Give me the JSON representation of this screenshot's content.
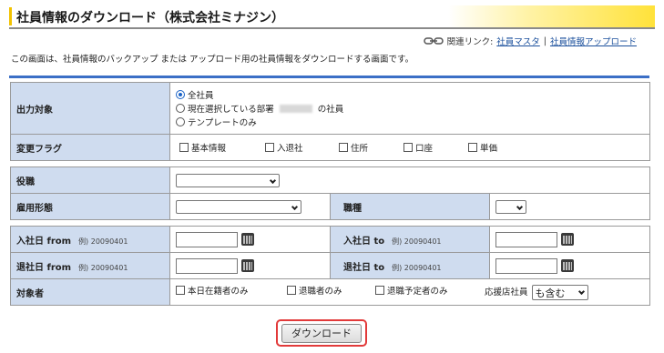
{
  "header": {
    "title": "社員情報のダウンロード（株式会社ミナジン）"
  },
  "related": {
    "prefix": "関連リンク:",
    "link1": "社員マスタ",
    "separator": "|",
    "link2": "社員情報アップロード"
  },
  "description": "この画面は、社員情報のバックアップ または アップロード用の社員情報をダウンロードする画面です。",
  "form": {
    "output_target": {
      "label": "出力対象",
      "options": [
        "全社員",
        "現在選択している部署",
        "テンプレートのみ"
      ],
      "option_suffix": "の社員",
      "selected": "全社員"
    },
    "change_flags": {
      "label": "変更フラグ",
      "options": [
        "基本情報",
        "入退社",
        "住所",
        "口座",
        "単価"
      ]
    },
    "position": {
      "label": "役職",
      "value": ""
    },
    "employment_type": {
      "label": "雇用形態",
      "value": ""
    },
    "job_type": {
      "label": "職種",
      "value": ""
    },
    "join_from": {
      "label": "入社日 from",
      "example": "例) 20090401"
    },
    "join_to": {
      "label": "入社日 to",
      "example": "例) 20090401"
    },
    "leave_from": {
      "label": "退社日 from",
      "example": "例) 20090401"
    },
    "leave_to": {
      "label": "退社日 to",
      "example": "例) 20090401"
    },
    "target": {
      "label": "対象者",
      "options": [
        "本日在籍者のみ",
        "退職者のみ",
        "退職予定者のみ"
      ],
      "support_label": "応援店社員",
      "support_value": "も含む"
    }
  },
  "download_button": "ダウンロード",
  "colors": {
    "label_bg": "#cfdcef",
    "accent_line": "#3b6fc6",
    "highlight": "#e23a3a"
  }
}
